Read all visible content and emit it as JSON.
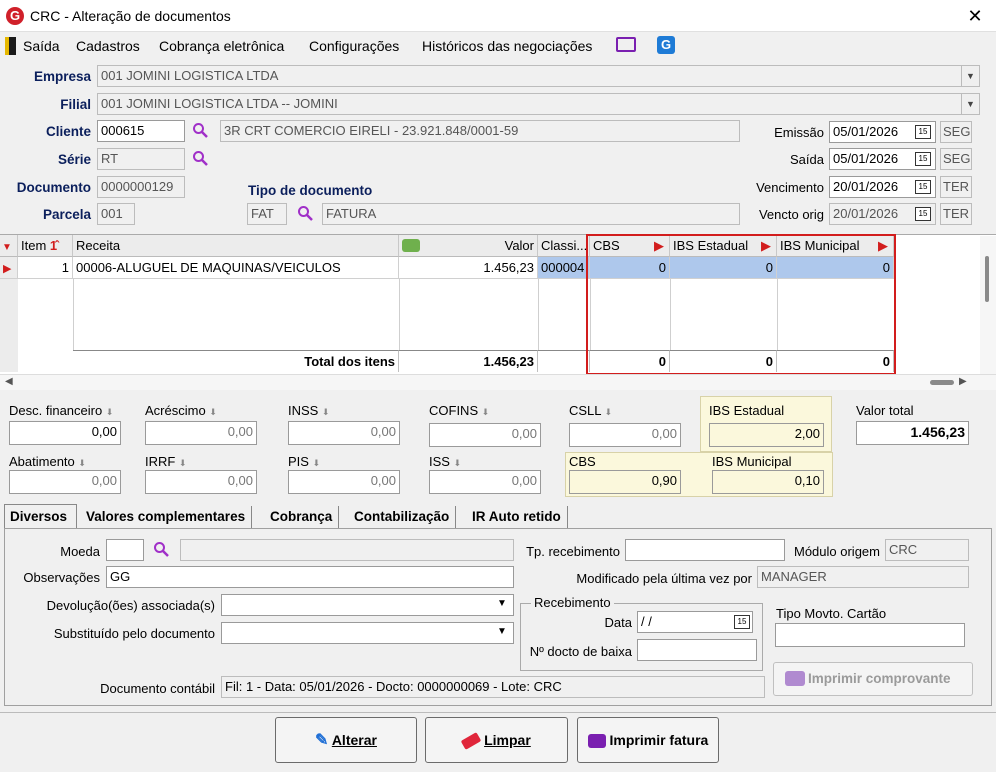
{
  "window": {
    "title": "CRC - Alteração de documentos",
    "app_icon": "G"
  },
  "menu": {
    "items": [
      "Saída",
      "Cadastros",
      "Cobrança eletrônica",
      "Configurações",
      "Históricos das negociações"
    ]
  },
  "header": {
    "empresa_label": "Empresa",
    "empresa_value": "001 JOMINI LOGISTICA LTDA",
    "filial_label": "Filial",
    "filial_value": "001 JOMINI LOGISTICA LTDA -- JOMINI",
    "cliente_label": "Cliente",
    "cliente_code": "000615",
    "cliente_name": "3R CRT COMERCIO EIRELI - 23.921.848/0001-59",
    "serie_label": "Série",
    "serie_value": "RT",
    "documento_label": "Documento",
    "documento_value": "0000000129",
    "parcela_label": "Parcela",
    "parcela_value": "001",
    "tipo_label": "Tipo de documento",
    "tipo_code": "FAT",
    "tipo_name": "FATURA",
    "emissao_label": "Emissão",
    "emissao_value": "05/01/2026",
    "emissao_day": "SEG",
    "saida_label": "Saída",
    "saida_value": "05/01/2026",
    "saida_day": "SEG",
    "vencimento_label": "Vencimento",
    "vencimento_value": "20/01/2026",
    "vencimento_day": "TER",
    "vencto_orig_label": "Vencto orig",
    "vencto_orig_value": "20/01/2026",
    "vencto_orig_day": "TER"
  },
  "grid": {
    "columns": [
      "Item",
      "Receita",
      "Valor",
      "Classi...",
      "CBS",
      "IBS Estadual",
      "IBS Municipal"
    ],
    "rows": [
      {
        "item": "1",
        "receita": "00006-ALUGUEL DE MAQUINAS/VEICULOS",
        "valor": "1.456,23",
        "classi": "000004",
        "cbs": "0",
        "ibs_estadual": "0",
        "ibs_municipal": "0"
      }
    ],
    "total_label": "Total dos itens",
    "total_valor": "1.456,23",
    "total_cbs": "0",
    "total_ibs_estadual": "0",
    "total_ibs_municipal": "0"
  },
  "totals": {
    "desc_financeiro": {
      "label": "Desc. financeiro",
      "value": "0,00"
    },
    "acrescimo": {
      "label": "Acréscimo",
      "value": "0,00"
    },
    "inss": {
      "label": "INSS",
      "value": "0,00"
    },
    "cofins": {
      "label": "COFINS",
      "value": "0,00"
    },
    "csll": {
      "label": "CSLL",
      "value": "0,00"
    },
    "ibs_estadual": {
      "label": "IBS Estadual",
      "value": "2,00"
    },
    "valor_total": {
      "label": "Valor total",
      "value": "1.456,23"
    },
    "abatimento": {
      "label": "Abatimento",
      "value": "0,00"
    },
    "irrf": {
      "label": "IRRF",
      "value": "0,00"
    },
    "pis": {
      "label": "PIS",
      "value": "0,00"
    },
    "iss": {
      "label": "ISS",
      "value": "0,00"
    },
    "cbs": {
      "label": "CBS",
      "value": "0,90"
    },
    "ibs_municipal": {
      "label": "IBS Municipal",
      "value": "0,10"
    }
  },
  "tabs": [
    "Diversos",
    "Valores complementares",
    "Cobrança",
    "Contabilização",
    "IR Auto retido"
  ],
  "diversos": {
    "moeda_label": "Moeda",
    "moeda_value": "",
    "observacoes_label": "Observações",
    "observacoes_value": "GG",
    "devolucoes_label": "Devolução(ões) associada(s)",
    "substituido_label": "Substituído pelo documento",
    "tp_recebimento_label": "Tp. recebimento",
    "tp_recebimento_value": "",
    "modulo_origem_label": "Módulo origem",
    "modulo_origem_value": "CRC",
    "modificado_label": "Modificado pela última vez por",
    "modificado_value": "MANAGER",
    "recebimento_label": "Recebimento",
    "data_label": "Data",
    "data_value": " /  /",
    "n_docto_baixa_label": "Nº docto de baixa",
    "n_docto_baixa_value": "",
    "tipo_movto_label": "Tipo Movto. Cartão",
    "tipo_movto_value": "",
    "imprimir_comprovante_label": "Imprimir comprovante",
    "doc_contabil_label": "Documento contábil",
    "doc_contabil_value": "Fil: 1 - Data: 05/01/2026 - Docto: 0000000069 - Lote: CRC"
  },
  "buttons": {
    "alterar": "Alterar",
    "limpar": "Limpar",
    "imprimir_fatura": "Imprimir fatura"
  }
}
